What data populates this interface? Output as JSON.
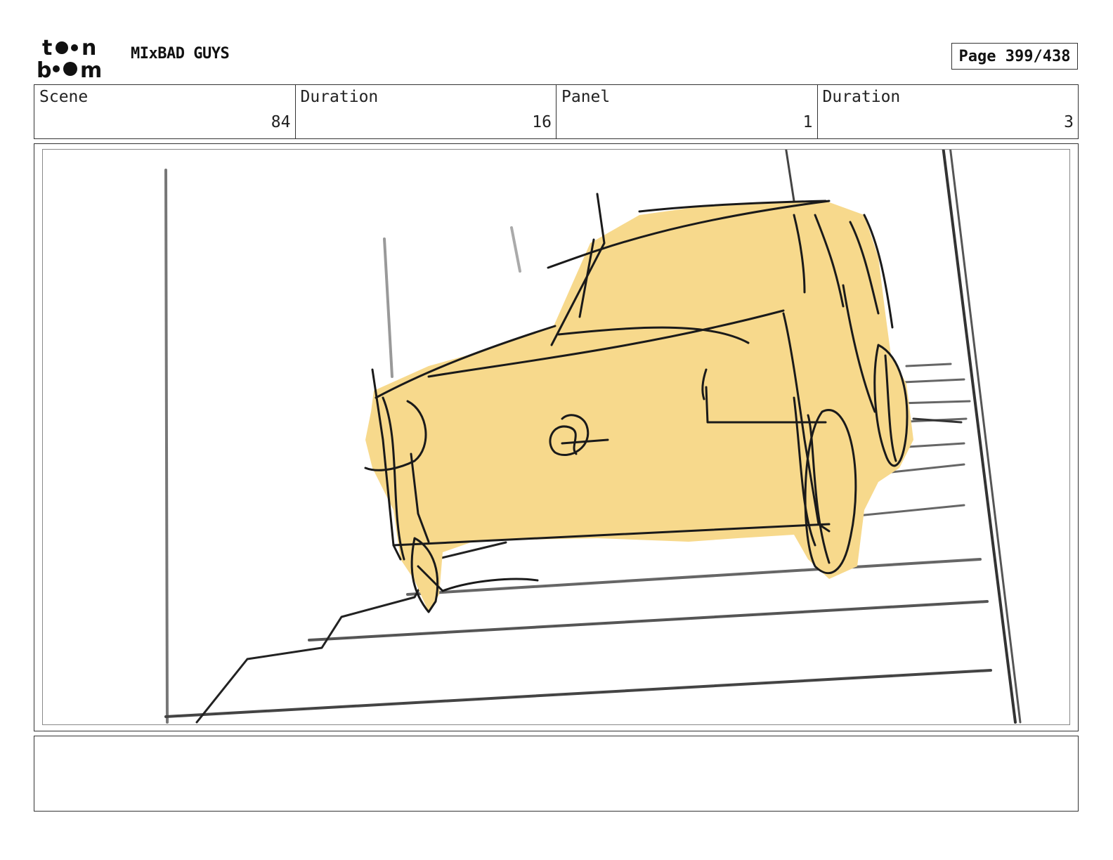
{
  "header": {
    "logo_text_top": "toon",
    "logo_text_bottom": "boom",
    "project_title": "MIxBAD GUYS",
    "page_label": "Page 399/438"
  },
  "info": {
    "scene_label": "Scene",
    "scene_value": "84",
    "scene_duration_label": "Duration",
    "scene_duration_value": "16",
    "panel_label": "Panel",
    "panel_value": "1",
    "panel_duration_label": "Duration",
    "panel_duration_value": "3"
  },
  "panel": {
    "sketch_subject": "car-on-stairs-sketch",
    "fill_color": "#F7D98C",
    "line_color": "#1a1a1a"
  },
  "notes": {
    "text": ""
  }
}
